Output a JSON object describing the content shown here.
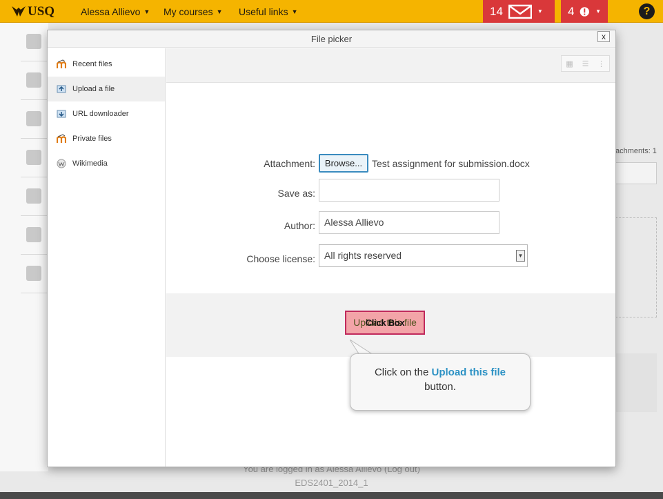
{
  "topbar": {
    "logo_text": "USQ",
    "user_menu": "Alessa Allievo",
    "courses_menu": "My courses",
    "links_menu": "Useful links",
    "messages_count": "14",
    "alerts_count": "4",
    "help_label": "?",
    "bar_color": "#f5b400",
    "badge_color": "#d9383a"
  },
  "dialog": {
    "title": "File picker",
    "close_label": "x",
    "repositories": [
      {
        "label": "Recent files",
        "icon": "moodle-logo-icon"
      },
      {
        "label": "Upload a file",
        "icon": "upload-icon"
      },
      {
        "label": "URL downloader",
        "icon": "url-icon"
      },
      {
        "label": "Private files",
        "icon": "moodle-logo-icon"
      },
      {
        "label": "Wikimedia",
        "icon": "wikimedia-icon"
      }
    ],
    "form": {
      "attachment_label": "Attachment:",
      "browse_label": "Browse...",
      "selected_file": "Test assignment for submission.docx",
      "saveas_label": "Save as:",
      "saveas_value": "",
      "author_label": "Author:",
      "author_value": "Alessa Allievo",
      "license_label": "Choose license:",
      "license_value": "All rights reserved"
    },
    "upload_button_label": "Upload this file"
  },
  "tutorial": {
    "click_box_label": "Click Box",
    "tooltip_prefix": "Click on the",
    "tooltip_highlight": "Upload this file",
    "tooltip_suffix": "button."
  },
  "background": {
    "attachments_text": "achments: 1",
    "footer_logged_in": "You are logged in as Alessa Allievo (Log out)",
    "footer_course": "EDS2401_2014_1"
  }
}
